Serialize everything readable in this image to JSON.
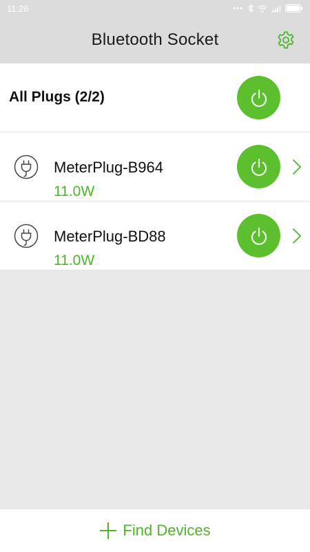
{
  "status_bar": {
    "time": "11:26",
    "icons": [
      "dots-icon",
      "bluetooth-icon",
      "wifi-icon",
      "signal-icon",
      "battery-icon"
    ]
  },
  "header": {
    "title": "Bluetooth Socket",
    "settings_icon": "gear-icon"
  },
  "all_plugs": {
    "label": "All Plugs (2/2)",
    "power_icon": "power-icon"
  },
  "devices": [
    {
      "name": "MeterPlug-B964",
      "power": "11.0W",
      "icon": "plug-icon"
    },
    {
      "name": "MeterPlug-BD88",
      "power": "11.0W",
      "icon": "plug-icon"
    }
  ],
  "footer": {
    "find_label": "Find Devices",
    "add_icon": "plus-icon"
  },
  "colors": {
    "accent": "#5cc02e",
    "header_bg": "#dcdcdc",
    "list_bg": "#ffffff",
    "empty_bg": "#e9e9e9"
  }
}
